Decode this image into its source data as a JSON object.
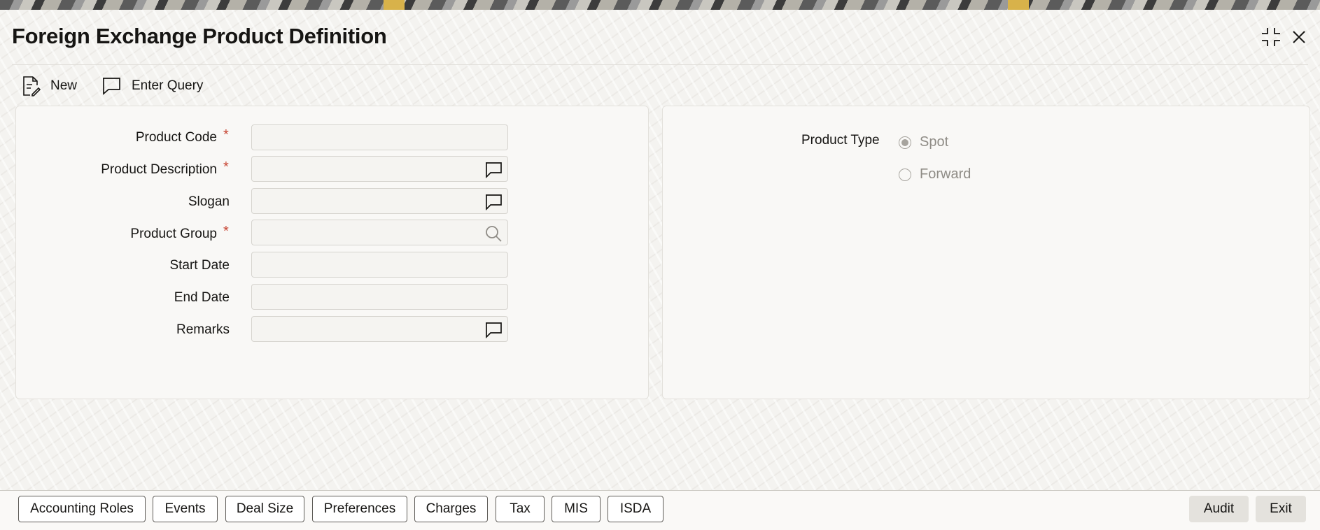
{
  "window": {
    "title": "Foreign Exchange Product Definition",
    "controls": {
      "restore_icon": "restore-icon",
      "close_icon": "close-icon"
    }
  },
  "toolbar": {
    "new_label": "New",
    "enter_query_label": "Enter Query"
  },
  "form": {
    "product_code": {
      "label": "Product Code",
      "value": "",
      "required": "*"
    },
    "product_description": {
      "label": "Product Description",
      "value": "",
      "required": "*"
    },
    "slogan": {
      "label": "Slogan",
      "value": ""
    },
    "product_group": {
      "label": "Product Group",
      "value": "",
      "required": "*"
    },
    "start_date": {
      "label": "Start Date",
      "value": ""
    },
    "end_date": {
      "label": "End Date",
      "value": ""
    },
    "remarks": {
      "label": "Remarks",
      "value": ""
    }
  },
  "product_type": {
    "label": "Product Type",
    "options": [
      {
        "label": "Spot",
        "selected": true
      },
      {
        "label": "Forward",
        "selected": false
      }
    ]
  },
  "bottom_tabs": [
    "Accounting Roles",
    "Events",
    "Deal Size",
    "Preferences",
    "Charges",
    "Tax",
    "MIS",
    "ISDA"
  ],
  "bottom_actions": {
    "audit_label": "Audit",
    "exit_label": "Exit"
  },
  "colors": {
    "required": "#c74634",
    "border": "#d6d4cf",
    "accent_gold": "#d8b24a"
  }
}
